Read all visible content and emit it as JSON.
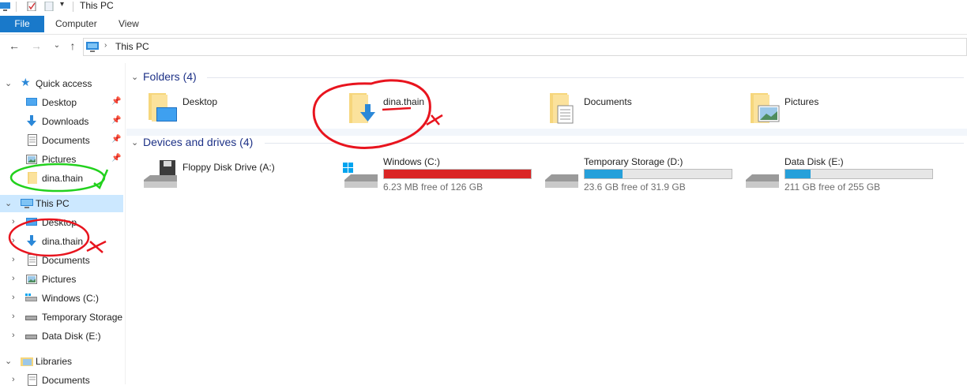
{
  "window": {
    "title": "This PC"
  },
  "ribbon": {
    "file": "File",
    "tabs": [
      "Computer",
      "View"
    ]
  },
  "address": {
    "path": "This PC"
  },
  "nav": {
    "quick_access": "Quick access",
    "quick_items": [
      "Desktop",
      "Downloads",
      "Documents",
      "Pictures",
      "dina.thain"
    ],
    "this_pc": "This PC",
    "pc_items": [
      "Desktop",
      "dina.thain",
      "Documents",
      "Pictures",
      "Windows (C:)",
      "Temporary Storage",
      "Data Disk (E:)"
    ],
    "libraries": "Libraries",
    "lib_items": [
      "Documents"
    ]
  },
  "main": {
    "folders_header": "Folders (4)",
    "folders": [
      "Desktop",
      "dina.thain",
      "Documents",
      "Pictures"
    ],
    "devices_header": "Devices and drives (4)",
    "floppy": "Floppy Disk Drive (A:)",
    "drives": [
      {
        "name": "Windows (C:)",
        "free": "6.23 MB free of 126 GB",
        "used_fraction": 0.9999,
        "color": "#da2626"
      },
      {
        "name": "Temporary Storage (D:)",
        "free": "23.6 GB free of 31.9 GB",
        "used_fraction": 0.26,
        "color": "#26a0da"
      },
      {
        "name": "Data Disk (E:)",
        "free": "211 GB free of 255 GB",
        "used_fraction": 0.17,
        "color": "#26a0da"
      }
    ]
  },
  "colors": {
    "accent": "#1979ca",
    "selection": "#cce8ff",
    "annotation_red": "#e8141e",
    "annotation_green": "#22d11d"
  }
}
